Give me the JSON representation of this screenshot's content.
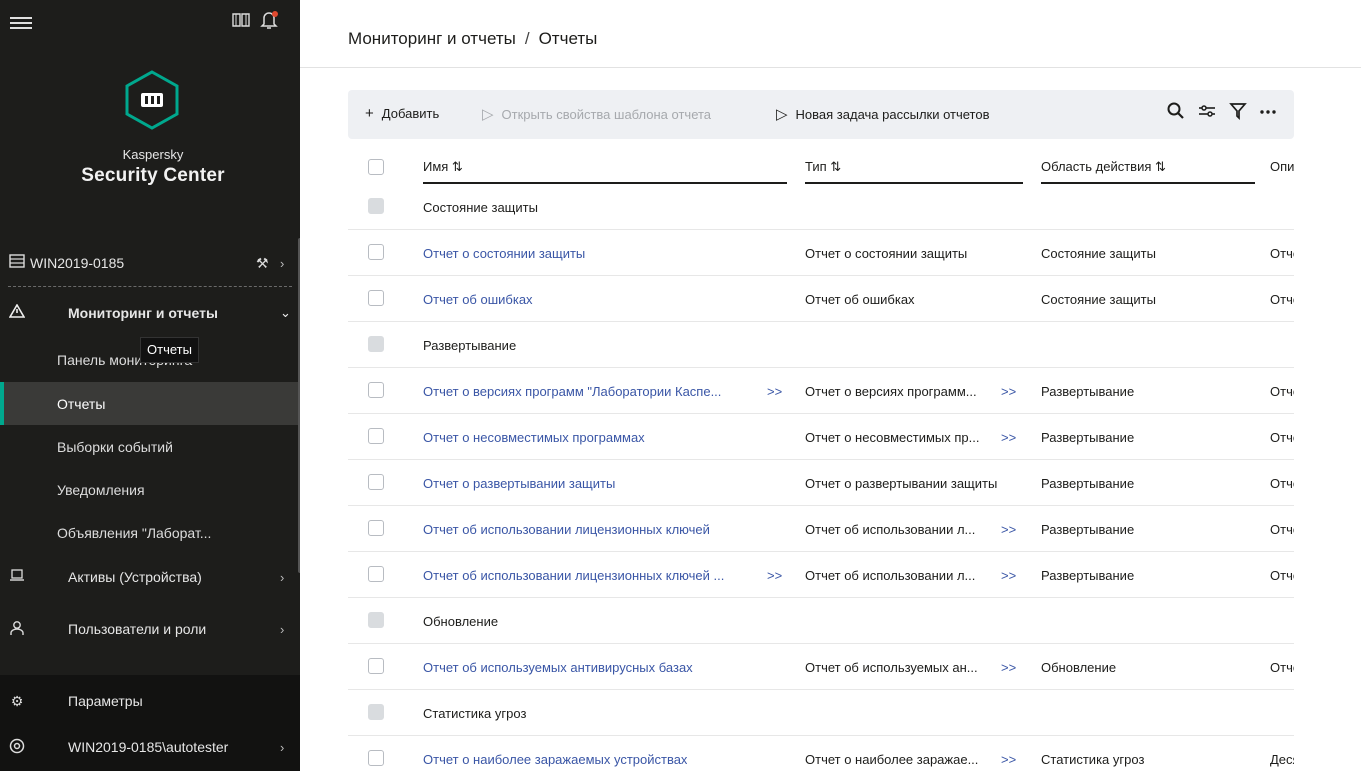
{
  "sidebar": {
    "brand_small": "Kaspersky",
    "brand_big": "Security Center",
    "server": "WIN2019-0185",
    "section": "Мониторинг и отчеты",
    "sub_items": [
      "Панель мониторинга",
      "Отчеты",
      "Выборки событий",
      "Уведомления",
      "Объявления \"Лаборат..."
    ],
    "tooltip": "Отчеты",
    "assets": "Активы (Устройства)",
    "users": "Пользователи и роли",
    "settings": "Параметры",
    "account": "WIN2019-0185\\autotester"
  },
  "breadcrumb": {
    "parent": "Мониторинг и отчеты",
    "sep": "/",
    "current": "Отчеты"
  },
  "toolbar": {
    "add": "Добавить",
    "open_props": "Открыть свойства шаблона отчета",
    "new_task": "Новая задача рассылки отчетов"
  },
  "columns": {
    "name": "Имя ⇅",
    "type": "Тип ⇅",
    "scope": "Область действия ⇅",
    "desc": "Описан"
  },
  "rows": [
    {
      "group": true,
      "name": "Состояние защиты"
    },
    {
      "group": false,
      "name": "Отчет о состоянии защиты",
      "name_more": "",
      "type": "Отчет о состоянии защиты",
      "type_more": "",
      "scope": "Состояние защиты",
      "desc": "Отчет с"
    },
    {
      "group": false,
      "name": "Отчет об ошибках",
      "name_more": "",
      "type": "Отчет об ошибках",
      "type_more": "",
      "scope": "Состояние защиты",
      "desc": "Отчет с"
    },
    {
      "group": true,
      "name": "Развертывание"
    },
    {
      "group": false,
      "name": "Отчет о версиях программ \"Лаборатории Каспе...",
      "name_more": ">>",
      "type": "Отчет о версиях программ...",
      "type_more": ">>",
      "scope": "Развертывание",
      "desc": "Отчет с"
    },
    {
      "group": false,
      "name": "Отчет о несовместимых программах",
      "name_more": "",
      "type": "Отчет о несовместимых пр...",
      "type_more": ">>",
      "scope": "Развертывание",
      "desc": "Отчет с"
    },
    {
      "group": false,
      "name": "Отчет о развертывании защиты",
      "name_more": "",
      "type": "Отчет о развертывании защиты",
      "type_more": "",
      "scope": "Развертывание",
      "desc": "Отчет с"
    },
    {
      "group": false,
      "name": "Отчет об использовании лицензионных ключей",
      "name_more": "",
      "type": "Отчет об использовании л...",
      "type_more": ">>",
      "scope": "Развертывание",
      "desc": "Отчет с"
    },
    {
      "group": false,
      "name": "Отчет об использовании лицензионных ключей ...",
      "name_more": ">>",
      "type": "Отчет об использовании л...",
      "type_more": ">>",
      "scope": "Развертывание",
      "desc": "Отчет с"
    },
    {
      "group": true,
      "name": "Обновление"
    },
    {
      "group": false,
      "name": "Отчет об используемых антивирусных базах",
      "name_more": "",
      "type": "Отчет об используемых ан...",
      "type_more": ">>",
      "scope": "Обновление",
      "desc": "Отчет с"
    },
    {
      "group": true,
      "name": "Статистика угроз"
    },
    {
      "group": false,
      "name": "Отчет о наиболее заражаемых устройствах",
      "name_more": "",
      "type": "Отчет о наиболее заражае...",
      "type_more": ">>",
      "scope": "Статистика угроз",
      "desc": "Десять"
    }
  ],
  "colors": {
    "accent": "#00a88e",
    "link": "#3a56a6",
    "sidebar_bg": "#1d1d1b",
    "notification": "#e0492f"
  },
  "icons": [
    "menu-icon",
    "book-icon",
    "bell-icon",
    "server-icon",
    "wrench-icon",
    "warning-icon",
    "laptop-icon",
    "user-icon",
    "gear-icon",
    "account-icon",
    "plus-icon",
    "play-icon",
    "search-icon",
    "filter-sliders-icon",
    "filter-icon",
    "more-icon"
  ]
}
